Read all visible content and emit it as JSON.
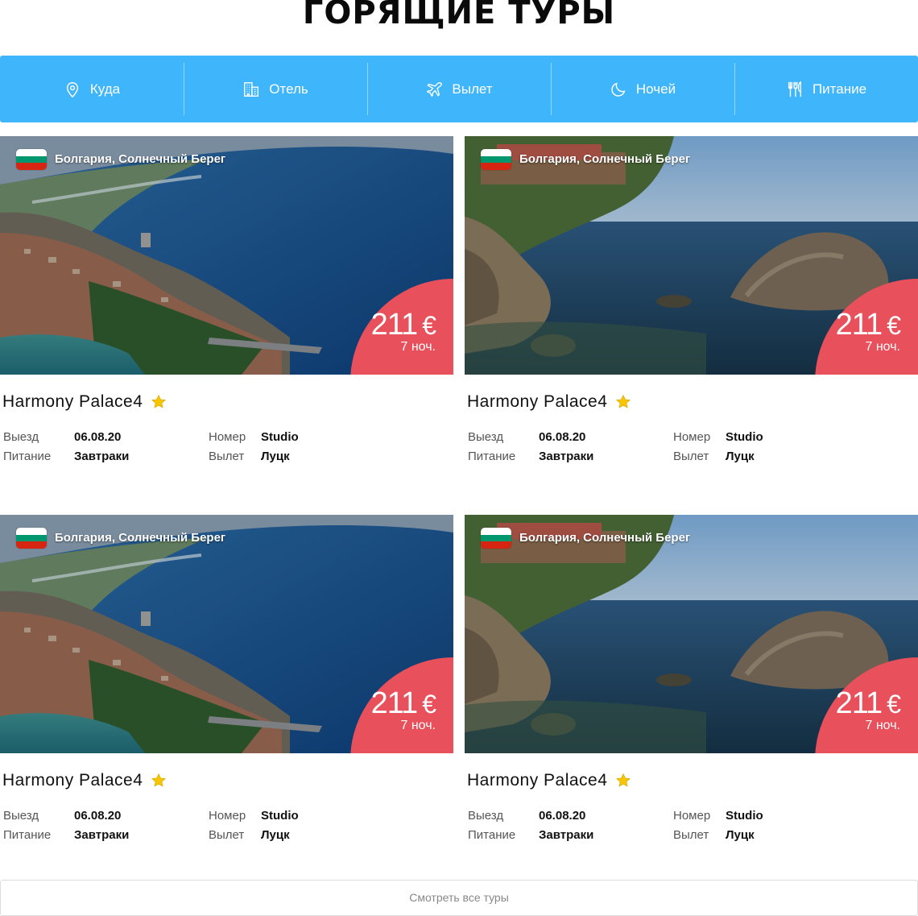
{
  "page": {
    "title": "ГОРЯЩИЕ ТУРЫ"
  },
  "filters": [
    {
      "label": "Куда",
      "icon": "location-pin-icon"
    },
    {
      "label": "Отель",
      "icon": "hotel-building-icon"
    },
    {
      "label": "Вылет",
      "icon": "airplane-icon"
    },
    {
      "label": "Ночей",
      "icon": "moon-icon"
    },
    {
      "label": "Питание",
      "icon": "fork-knife-icon"
    }
  ],
  "colors": {
    "accent": "#3fb5fb",
    "badge": "#e8505b",
    "star": "#f7c600"
  },
  "labels": {
    "departure": "Выезд",
    "meal": "Питание",
    "room": "Номер",
    "flight": "Вылет"
  },
  "tours": [
    {
      "location": "Болгария, Солнечный Берег",
      "price": "211",
      "currency": "€",
      "nights": "7 ноч.",
      "hotel": "Harmony Palace4",
      "departure": "06.08.20",
      "meal": "Завтраки",
      "room": "Studio",
      "flight": "Луцк",
      "photo": "coast-aerial"
    },
    {
      "location": "Болгария, Солнечный Берег",
      "price": "211",
      "currency": "€",
      "nights": "7 ноч.",
      "hotel": "Harmony Palace4",
      "departure": "06.08.20",
      "meal": "Завтраки",
      "room": "Studio",
      "flight": "Луцк",
      "photo": "rocky-shore"
    },
    {
      "location": "Болгария, Солнечный Берег",
      "price": "211",
      "currency": "€",
      "nights": "7 ноч.",
      "hotel": "Harmony Palace4",
      "departure": "06.08.20",
      "meal": "Завтраки",
      "room": "Studio",
      "flight": "Луцк",
      "photo": "coast-aerial"
    },
    {
      "location": "Болгария, Солнечный Берег",
      "price": "211",
      "currency": "€",
      "nights": "7 ноч.",
      "hotel": "Harmony Palace4",
      "departure": "06.08.20",
      "meal": "Завтраки",
      "room": "Studio",
      "flight": "Луцк",
      "photo": "rocky-shore"
    }
  ],
  "more_button": "Смотреть все туры"
}
